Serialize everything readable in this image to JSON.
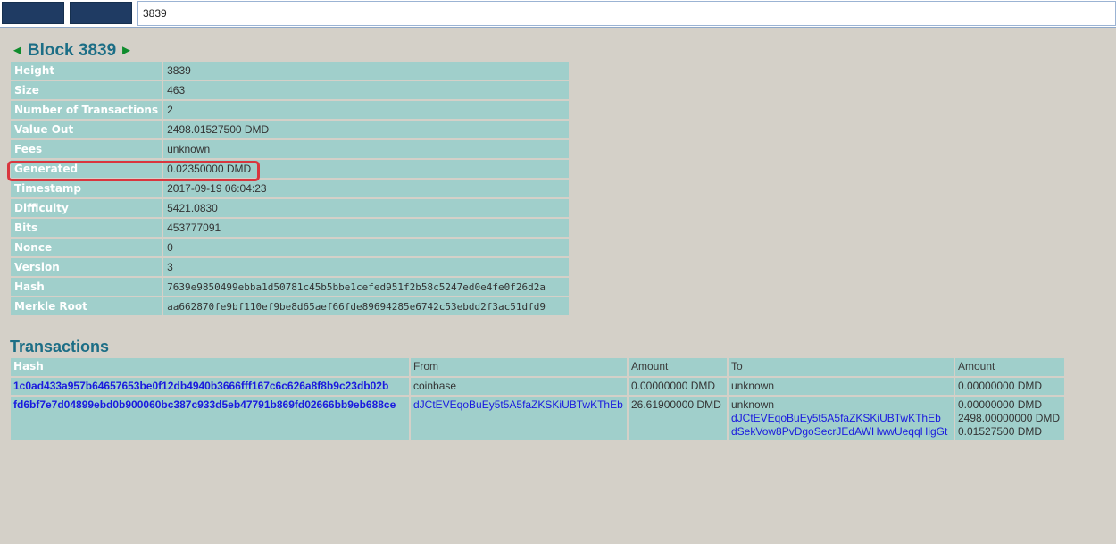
{
  "search": {
    "value": "3839"
  },
  "block": {
    "title": "Block 3839",
    "prev_arrow": "◄",
    "next_arrow": "►",
    "rows": [
      {
        "label": "Height",
        "value": "3839"
      },
      {
        "label": "Size",
        "value": "463"
      },
      {
        "label": "Number of Transactions",
        "value": "2"
      },
      {
        "label": "Value Out",
        "value": "2498.01527500 DMD"
      },
      {
        "label": "Fees",
        "value": "unknown"
      },
      {
        "label": "Generated",
        "value": "0.02350000 DMD"
      },
      {
        "label": "Timestamp",
        "value": "2017-09-19 06:04:23"
      },
      {
        "label": "Difficulty",
        "value": "5421.0830"
      },
      {
        "label": "Bits",
        "value": "453777091"
      },
      {
        "label": "Nonce",
        "value": "0"
      },
      {
        "label": "Version",
        "value": "3"
      },
      {
        "label": "Hash",
        "value": "7639e9850499ebba1d50781c45b5bbe1cefed951f2b58c5247ed0e4fe0f26d2a"
      },
      {
        "label": "Merkle Root",
        "value": "aa662870fe9bf110ef9be8d65aef66fde89694285e6742c53ebdd2f3ac51dfd9"
      }
    ]
  },
  "transactions": {
    "title": "Transactions",
    "headers": [
      "Hash",
      "From",
      "Amount",
      "To",
      "Amount"
    ],
    "rows": [
      {
        "hash": "1c0ad433a957b64657653be0f12db4940b3666fff167c6c626a8f8b9c23db02b",
        "from": "coinbase",
        "from_amount": "0.00000000 DMD",
        "to": [
          "unknown"
        ],
        "to_amounts": [
          "0.00000000 DMD"
        ]
      },
      {
        "hash": "fd6bf7e7d04899ebd0b900060bc387c933d5eb47791b869fd02666bb9eb688ce",
        "from": "dJCtEVEqoBuEy5t5A5faZKSKiUBTwKThEb",
        "from_amount": "26.61900000 DMD",
        "to": [
          "unknown",
          "dJCtEVEqoBuEy5t5A5faZKSKiUBTwKThEb",
          "dSekVow8PvDgoSecrJEdAWHwwUeqqHigGt"
        ],
        "to_amounts": [
          "0.00000000 DMD",
          "2498.00000000 DMD",
          "0.01527500 DMD"
        ]
      }
    ]
  },
  "colors": {
    "background": "#d4d0c8",
    "cell": "#a0cfcb",
    "title": "#1c6e86",
    "arrow": "#0f8c2d",
    "link": "#1a1adf",
    "highlight": "#d9363e"
  }
}
